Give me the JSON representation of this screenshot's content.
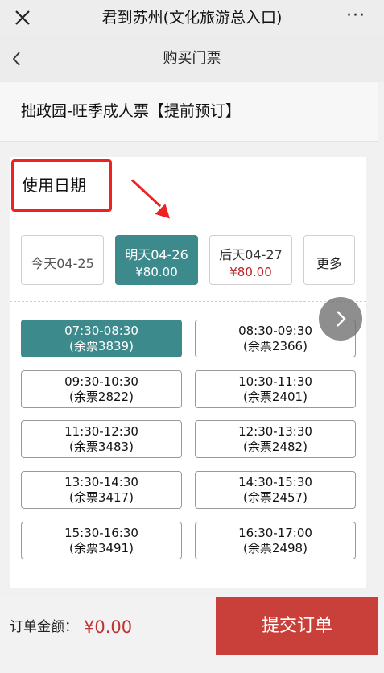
{
  "window": {
    "title": "君到苏州(文化旅游总入口)",
    "more_label": "···"
  },
  "nav": {
    "title": "购买门票"
  },
  "ticket": {
    "name": "拙政园-旺季成人票【提前预订】"
  },
  "date_section": {
    "heading": "使用日期"
  },
  "days": [
    {
      "date": "今天04-25",
      "price": ""
    },
    {
      "date": "明天04-26",
      "price": "¥80.00",
      "selected": true
    },
    {
      "date": "后天04-27",
      "price": "¥80.00"
    },
    {
      "date": "更多",
      "price": ""
    }
  ],
  "slots": [
    {
      "time": "07:30-08:30",
      "remain": "(余票3839)",
      "selected": true
    },
    {
      "time": "08:30-09:30",
      "remain": "(余票2366)"
    },
    {
      "time": "09:30-10:30",
      "remain": "(余票2822)"
    },
    {
      "time": "10:30-11:30",
      "remain": "(余票2401)"
    },
    {
      "time": "11:30-12:30",
      "remain": "(余票3483)"
    },
    {
      "time": "12:30-13:30",
      "remain": "(余票2482)"
    },
    {
      "time": "13:30-14:30",
      "remain": "(余票3417)"
    },
    {
      "time": "14:30-15:30",
      "remain": "(余票2457)"
    },
    {
      "time": "15:30-16:30",
      "remain": "(余票3491)"
    },
    {
      "time": "16:30-17:00",
      "remain": "(余票2498)"
    }
  ],
  "footer": {
    "amount_label": "订单金额：",
    "amount": "¥0.00",
    "submit_label": "提交订单"
  },
  "colors": {
    "accent": "#3d8a8c",
    "price_red": "#b22222",
    "submit_red": "#c9403a",
    "annotation_red": "#ee2222"
  }
}
